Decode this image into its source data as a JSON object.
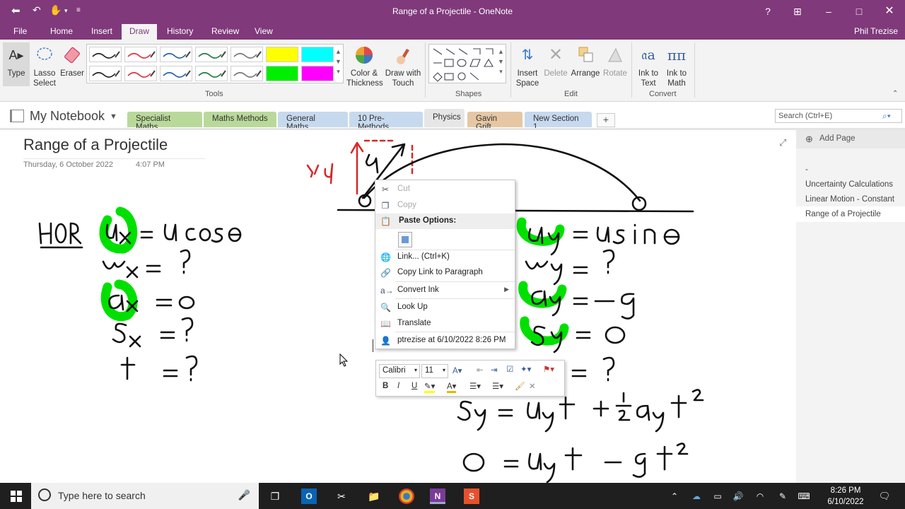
{
  "window": {
    "title": "Range of a Projectile - OneNote",
    "help": "?",
    "user": "Phil Trezise"
  },
  "menu": {
    "tabs": [
      "File",
      "Home",
      "Insert",
      "Draw",
      "History",
      "Review",
      "View"
    ],
    "active": "Draw"
  },
  "ribbon": {
    "type": "Type",
    "lasso": "Lasso Select",
    "eraser": "Eraser",
    "color_thickness": "Color & Thickness",
    "draw_touch": "Draw with Touch",
    "insert_space": "Insert Space",
    "delete": "Delete",
    "arrange": "Arrange",
    "rotate": "Rotate",
    "ink_text": "Ink to Text",
    "ink_math": "Ink to Math",
    "groups": {
      "tools": "Tools",
      "shapes": "Shapes",
      "edit": "Edit",
      "convert": "Convert"
    },
    "pen_colors": [
      "#222222",
      "#d9323a",
      "#2a5fa8",
      "#1e7a3e",
      "#777777",
      "#ffff00",
      "#00ffff",
      "#222222",
      "#d9323a",
      "#2a5fa8",
      "#1e7a3e",
      "#777777",
      "#00ee00",
      "#ff00ff"
    ]
  },
  "notebook": {
    "name": "My Notebook",
    "sections": [
      {
        "label": "Specialist Maths",
        "color": "#b9d99a"
      },
      {
        "label": "Maths Methods",
        "color": "#b9d99a"
      },
      {
        "label": "General Maths",
        "color": "#c6d9ee"
      },
      {
        "label": "10 Pre-Methods",
        "color": "#c6d9ee"
      },
      {
        "label": "Physics",
        "color": "#e6e6e6"
      },
      {
        "label": "Gavin Grift",
        "color": "#e6c7a3"
      },
      {
        "label": "New Section 1",
        "color": "#c6d9ee"
      }
    ],
    "add_section": "+",
    "search_placeholder": "Search (Ctrl+E)"
  },
  "page": {
    "title": "Range of a Projectile",
    "date": "Thursday, 6 October 2022",
    "time": "4:07 PM"
  },
  "pages_panel": {
    "add_page": "Add Page",
    "items": [
      "-",
      "Uncertainty Calculations",
      "Linear Motion - Constant",
      "Range of a Projectile"
    ],
    "selected": "Range of a Projectile"
  },
  "context_menu": {
    "cut": "Cut",
    "copy": "Copy",
    "paste_options": "Paste Options:",
    "link": "Link...  (Ctrl+K)",
    "copy_link": "Copy Link to Paragraph",
    "convert_ink": "Convert Ink",
    "look_up": "Look Up",
    "translate": "Translate",
    "author": "ptrezise at 6/10/2022 8:26 PM"
  },
  "mini_toolbar": {
    "font": "Calibri",
    "size": "11",
    "bold": "B",
    "italic": "I",
    "underline": "U"
  },
  "taskbar": {
    "search_placeholder": "Type here to search",
    "time": "8:26 PM",
    "date": "6/10/2022"
  }
}
